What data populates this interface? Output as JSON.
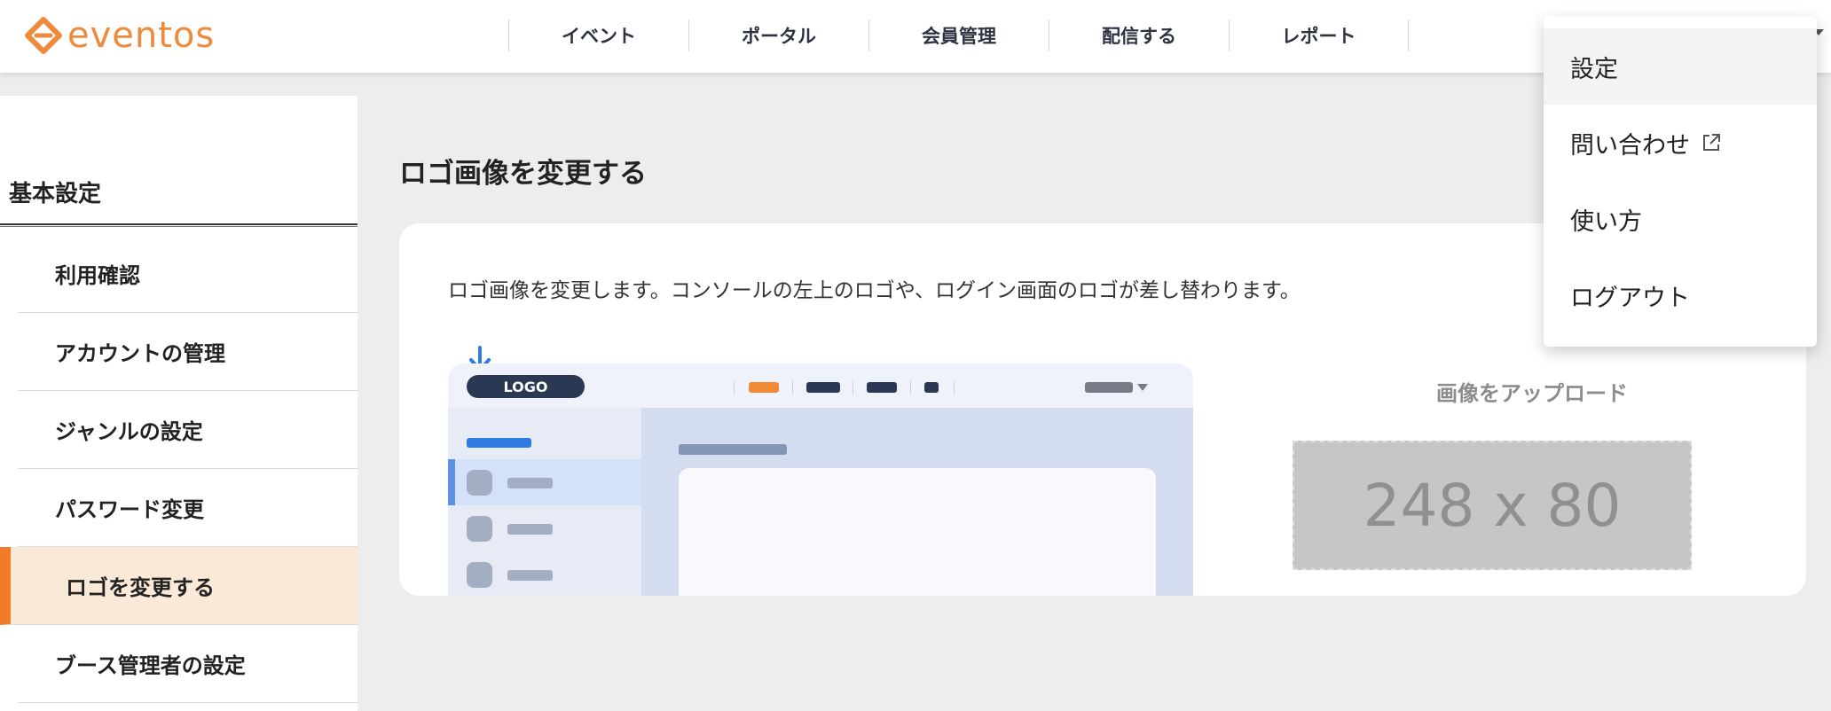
{
  "brand": {
    "name": "eventos",
    "color": "#ee8a3c"
  },
  "nav": {
    "items": [
      "イベント",
      "ポータル",
      "会員管理",
      "配信する",
      "レポート"
    ]
  },
  "sidebar": {
    "title": "基本設定",
    "items": [
      {
        "label": "利用確認",
        "active": false
      },
      {
        "label": "アカウントの管理",
        "active": false
      },
      {
        "label": "ジャンルの設定",
        "active": false
      },
      {
        "label": "パスワード変更",
        "active": false
      },
      {
        "label": "ロゴを変更する",
        "active": true
      },
      {
        "label": "ブース管理者の設定",
        "active": false
      }
    ],
    "active_color": "#f07c2a"
  },
  "main": {
    "title": "ロゴ画像を変更する",
    "description": "ロゴ画像を変更します。コンソールの左上のロゴや、ログイン画面のロゴが差し替わります。",
    "mock_logo_label": "LOGO",
    "upload_label": "画像をアップロード",
    "upload_placeholder": "248 x 80"
  },
  "dropdown": {
    "items": [
      "設定",
      "問い合わせ",
      "使い方",
      "ログアウト"
    ],
    "external_icon": "external-link-icon"
  }
}
